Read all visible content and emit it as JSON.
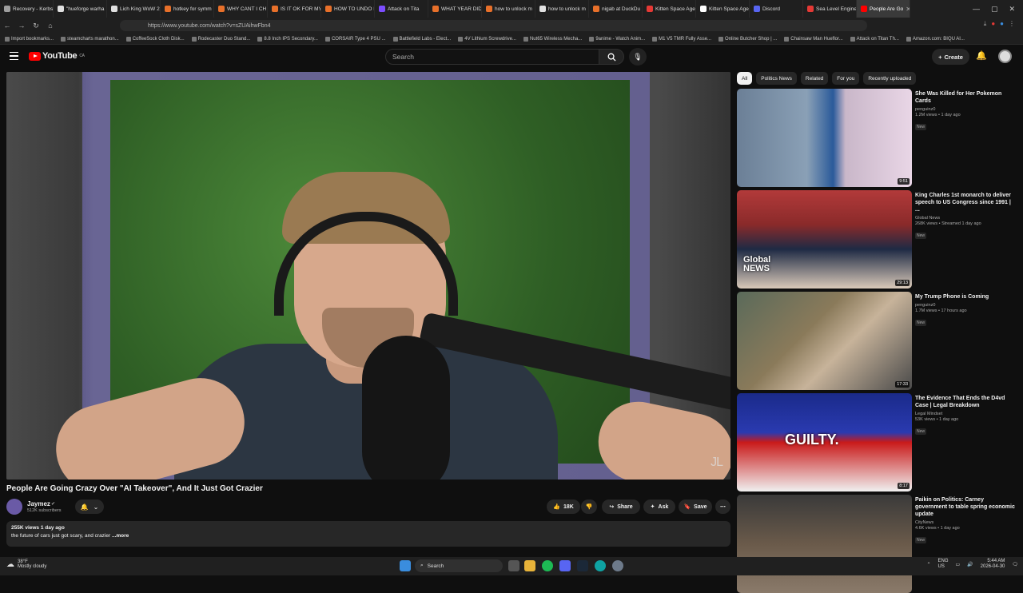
{
  "browser": {
    "tabs": [
      {
        "label": "Recovery - Kerbs",
        "color": "#9e9e9e"
      },
      {
        "label": "\"hueforge warha",
        "color": "#e0e0e0"
      },
      {
        "label": "Lich King WoW 2",
        "color": "#e0e0e0"
      },
      {
        "label": "hotkey for symm",
        "color": "#e8702a"
      },
      {
        "label": "WHY CANT I CH",
        "color": "#e8702a"
      },
      {
        "label": "IS IT OK FOR MY",
        "color": "#e8702a"
      },
      {
        "label": "HOW TO UNDO I",
        "color": "#e8702a"
      },
      {
        "label": "Attack on Tita",
        "color": "#7c4dff"
      },
      {
        "label": "WHAT YEAR DID",
        "color": "#e8702a"
      },
      {
        "label": "how to unlock m",
        "color": "#e8702a"
      },
      {
        "label": "how to unlock m",
        "color": "#e0e0e0"
      },
      {
        "label": "nigab at DuckDu",
        "color": "#e8702a"
      },
      {
        "label": "Kitten Space Age",
        "color": "#e53935"
      },
      {
        "label": "Kitten Space Age",
        "color": "#ffffff"
      },
      {
        "label": "Discord",
        "color": "#5865f2"
      },
      {
        "label": "Sea Level Engine",
        "color": "#e53935"
      },
      {
        "label": "People Are Go",
        "color": "#ff0000",
        "active": true
      }
    ],
    "url": "https://www.youtube.com/watch?v=sZUAihwFbn4",
    "bookmarks": [
      "Import bookmarks...",
      "steamcharts marathon...",
      "CoffeeSock Cloth Disk...",
      "Rodecaster Duo Stand...",
      "8.8 Inch IPS Secondary...",
      "CORSAIR Type 4 PSU ...",
      "Battlefield Labs - Elect...",
      "4V Lithium Screwdrive...",
      "Nut65 Wireless Mecha...",
      "9anime - Watch Anim...",
      "M1 V5 TMR Fully Asse...",
      "Online Butcher Shop | ...",
      "Chainsaw Man Hueflor...",
      "Attack on Titan Th...",
      "Amazon.com: BIQU AI..."
    ]
  },
  "youtube": {
    "logo": "YouTube",
    "region": "CA",
    "search_placeholder": "Search",
    "create_label": "Create"
  },
  "video": {
    "title": "People Are Going Crazy Over \"AI Takeover\", And It Just Got Crazier",
    "watermark": "JL",
    "channel": "Jaymez",
    "subscribers": "512K subscribers",
    "likes": "18K",
    "share_label": "Share",
    "ask_label": "Ask",
    "save_label": "Save",
    "views_date": "255K views  1 day ago",
    "description": "the future of cars just got scary, and crazier",
    "more_label": "...more"
  },
  "chips": [
    {
      "label": "All",
      "selected": true
    },
    {
      "label": "Politics News"
    },
    {
      "label": "Related"
    },
    {
      "label": "For you"
    },
    {
      "label": "Recently uploaded"
    }
  ],
  "recommendations": [
    {
      "title": "She Was Killed for Her Pokemon Cards",
      "channel": "penguinz0",
      "meta": "1.2M views • 1 day ago",
      "badge": "New",
      "duration": "9:51"
    },
    {
      "title": "King Charles 1st monarch to deliver speech to US Congress since 1991 | ...",
      "channel": "Global News",
      "meta": "268K views • Streamed 1 day ago",
      "badge": "New",
      "duration": "29:13",
      "overlay": "Global NEWS"
    },
    {
      "title": "My Trump Phone is Coming",
      "channel": "penguinz0",
      "meta": "1.7M views • 17 hours ago",
      "badge": "New",
      "duration": "17:33"
    },
    {
      "title": "The Evidence That Ends the D4vd Case | Legal Breakdown",
      "channel": "Legal Mindset",
      "meta": "53K views • 1 day ago",
      "badge": "New",
      "duration": "8:17",
      "overlay": "GUILTY."
    },
    {
      "title": "Paikin on Politics: Carney government to table spring economic update",
      "channel": "CityNews",
      "meta": "4.6K views • 1 day ago",
      "badge": "New",
      "duration": ""
    }
  ],
  "taskbar": {
    "temperature": "38°F",
    "weather": "Mostly cloudy",
    "search_label": "Search",
    "lang": "ENG",
    "region": "US",
    "time": "5:44 AM",
    "date": "2026-04-30"
  }
}
